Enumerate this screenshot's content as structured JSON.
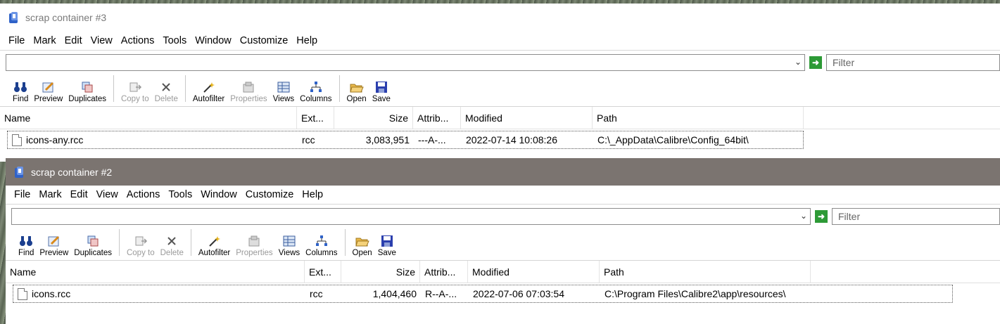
{
  "windows": [
    {
      "title": "scrap container #3",
      "menu": [
        "File",
        "Mark",
        "Edit",
        "View",
        "Actions",
        "Tools",
        "Window",
        "Customize",
        "Help"
      ],
      "filter_placeholder": "Filter",
      "toolbar": [
        {
          "label": "Find",
          "icon": "binoculars-icon",
          "enabled": true
        },
        {
          "label": "Preview",
          "icon": "preview-icon",
          "enabled": true
        },
        {
          "label": "Duplicates",
          "icon": "duplicates-icon",
          "enabled": true
        },
        {
          "label": "Copy to",
          "icon": "copy-to-icon",
          "enabled": false
        },
        {
          "label": "Delete",
          "icon": "delete-icon",
          "enabled": false
        },
        {
          "label": "Autofilter",
          "icon": "autofilter-icon",
          "enabled": true
        },
        {
          "label": "Properties",
          "icon": "properties-icon",
          "enabled": false
        },
        {
          "label": "Views",
          "icon": "views-icon",
          "enabled": true
        },
        {
          "label": "Columns",
          "icon": "columns-icon",
          "enabled": true
        },
        {
          "label": "Open",
          "icon": "open-folder-icon",
          "enabled": true
        },
        {
          "label": "Save",
          "icon": "save-icon",
          "enabled": true
        }
      ],
      "columns": [
        "Name",
        "Ext...",
        "Size",
        "Attrib...",
        "Modified",
        "Path"
      ],
      "rows": [
        {
          "name": "icons-any.rcc",
          "ext": "rcc",
          "size": "3,083,951",
          "attrib": "---A-...",
          "modified": "2022-07-14 10:08:26",
          "path": "C:\\_AppData\\Calibre\\Config_64bit\\"
        }
      ]
    },
    {
      "title": "scrap container #2",
      "menu": [
        "File",
        "Mark",
        "Edit",
        "View",
        "Actions",
        "Tools",
        "Window",
        "Customize",
        "Help"
      ],
      "filter_placeholder": "Filter",
      "toolbar": [
        {
          "label": "Find",
          "icon": "binoculars-icon",
          "enabled": true
        },
        {
          "label": "Preview",
          "icon": "preview-icon",
          "enabled": true
        },
        {
          "label": "Duplicates",
          "icon": "duplicates-icon",
          "enabled": true
        },
        {
          "label": "Copy to",
          "icon": "copy-to-icon",
          "enabled": false
        },
        {
          "label": "Delete",
          "icon": "delete-icon",
          "enabled": false
        },
        {
          "label": "Autofilter",
          "icon": "autofilter-icon",
          "enabled": true
        },
        {
          "label": "Properties",
          "icon": "properties-icon",
          "enabled": false
        },
        {
          "label": "Views",
          "icon": "views-icon",
          "enabled": true
        },
        {
          "label": "Columns",
          "icon": "columns-icon",
          "enabled": true
        },
        {
          "label": "Open",
          "icon": "open-folder-icon",
          "enabled": true
        },
        {
          "label": "Save",
          "icon": "save-icon",
          "enabled": true
        }
      ],
      "columns": [
        "Name",
        "Ext...",
        "Size",
        "Attrib...",
        "Modified",
        "Path"
      ],
      "rows": [
        {
          "name": "icons.rcc",
          "ext": "rcc",
          "size": "1,404,460",
          "attrib": "R--A-...",
          "modified": "2022-07-06 07:03:54",
          "path": "C:\\Program Files\\Calibre2\\app\\resources\\"
        }
      ]
    }
  ],
  "colors": {
    "active_title_bg": "#7b7470",
    "go_button": "#2d9a36",
    "app_icon": "#2f62c8"
  }
}
